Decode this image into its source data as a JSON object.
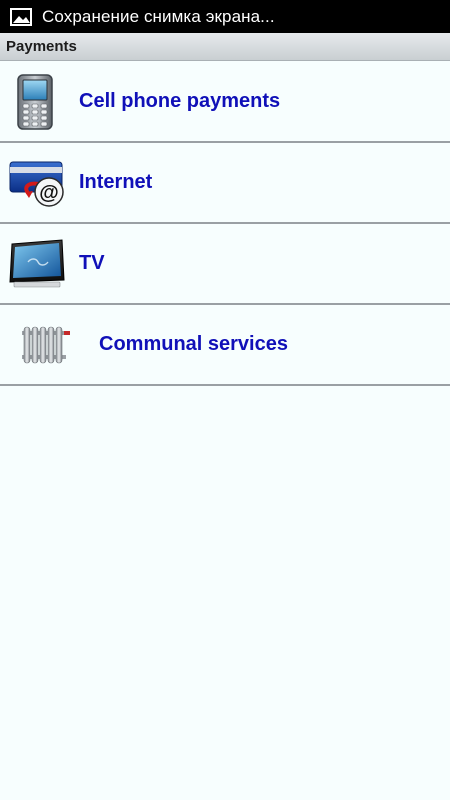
{
  "status_bar": {
    "notification_icon": "image-icon",
    "text": "Сохранение снимка экрана..."
  },
  "header": {
    "title": "Payments"
  },
  "items": [
    {
      "label": "Cell phone payments",
      "icon": "cell-phone-icon"
    },
    {
      "label": "Internet",
      "icon": "credit-card-at-icon"
    },
    {
      "label": "TV",
      "icon": "tv-icon"
    },
    {
      "label": "Communal services",
      "icon": "radiator-icon"
    }
  ],
  "colors": {
    "label": "#1010b8",
    "background": "#f7fefe",
    "divider": "#9aa0a4"
  }
}
